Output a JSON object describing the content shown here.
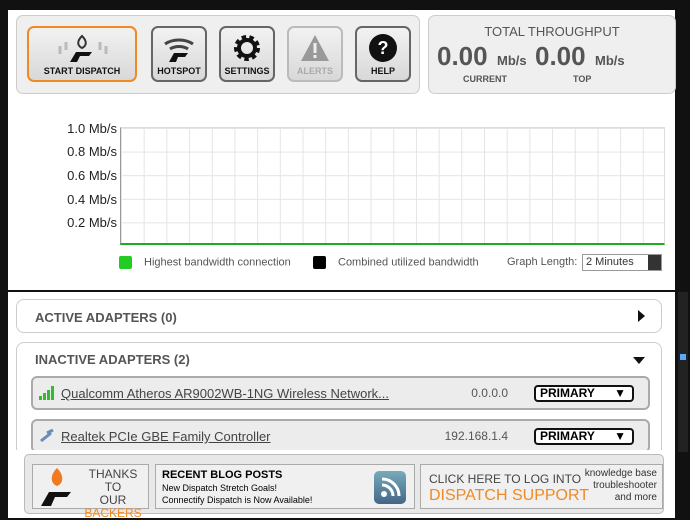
{
  "toolbar": {
    "buttons": [
      {
        "label": "START DISPATCH"
      },
      {
        "label": "HOTSPOT"
      },
      {
        "label": "SETTINGS"
      },
      {
        "label": "ALERTS"
      },
      {
        "label": "HELP"
      }
    ]
  },
  "throughput": {
    "title": "TOTAL THROUGHPUT",
    "current": "0.00",
    "current_unit": "Mb/s",
    "current_label": "CURRENT",
    "top": "0.00",
    "top_unit": "Mb/s",
    "top_label": "TOP"
  },
  "chart_data": {
    "type": "line",
    "ylabels": [
      "1.0 Mb/s",
      "0.8 Mb/s",
      "0.6 Mb/s",
      "0.4 Mb/s",
      "0.2 Mb/s"
    ],
    "ylim": [
      0,
      1.0
    ],
    "series": [
      {
        "name": "Highest bandwidth connection",
        "color": "#22cc22",
        "values": [
          0
        ]
      },
      {
        "name": "Combined utilized bandwidth",
        "color": "#000000",
        "values": [
          0
        ]
      }
    ],
    "graph_length_label": "Graph Length:",
    "graph_length": "2 Minutes"
  },
  "adapters": {
    "active_title": "ACTIVE ADAPTERS (0)",
    "inactive_title": "INACTIVE ADAPTERS (2)",
    "inactive": [
      {
        "name": "Qualcomm Atheros AR9002WB-1NG Wireless Network...",
        "ip": "0.0.0.0",
        "mode": "PRIMARY"
      },
      {
        "name": "Realtek PCIe GBE Family Controller",
        "ip": "192.168.1.4",
        "mode": "PRIMARY"
      }
    ]
  },
  "footer": {
    "thanks1": "THANKS TO",
    "thanks2": "OUR",
    "thanks3": "BACKERS",
    "blog_title": "RECENT BLOG POSTS",
    "blog_posts": [
      "New Dispatch Stretch Goals!",
      "Connectify Dispatch is Now Available!"
    ],
    "support1": "CLICK HERE TO LOG INTO",
    "support2": "DISPATCH SUPPORT",
    "support_extra": [
      "knowledge base",
      "troubleshooter",
      "and more"
    ]
  }
}
